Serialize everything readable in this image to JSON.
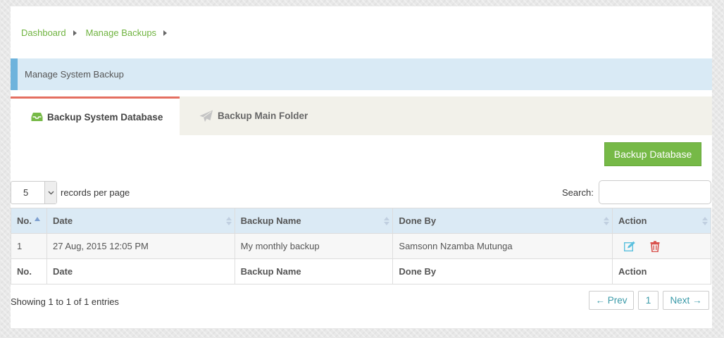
{
  "breadcrumb": [
    {
      "label": "Dashboard"
    },
    {
      "label": "Manage Backups"
    }
  ],
  "page_header": "Manage System Backup",
  "tabs": [
    {
      "label": "Backup System Database",
      "icon": "inbox-icon",
      "active": true
    },
    {
      "label": "Backup Main Folder",
      "icon": "paper-plane-icon",
      "active": false
    }
  ],
  "backup_button": "Backup Database",
  "length": {
    "value": "5",
    "label": "records per page"
  },
  "search": {
    "label": "Search:",
    "value": ""
  },
  "table": {
    "headers": [
      "No.",
      "Date",
      "Backup Name",
      "Done By",
      "Action"
    ],
    "rows": [
      {
        "no": "1",
        "date": "27 Aug, 2015 12:05 PM",
        "name": "My monthly backup",
        "done_by": "Samsonn Nzamba Mutunga"
      }
    ],
    "footers": [
      "No.",
      "Date",
      "Backup Name",
      "Done By",
      "Action"
    ]
  },
  "info": "Showing 1 to 1 of 1 entries",
  "pager": {
    "prev": "← Prev",
    "page": "1",
    "next": "Next →"
  },
  "colors": {
    "accent_green": "#76b947",
    "link_green": "#6fb33f",
    "tab_active_border": "#e46f61",
    "header_blue": "#dbeaf5",
    "edit_icon": "#5bc0de",
    "delete_icon": "#d9534f"
  }
}
